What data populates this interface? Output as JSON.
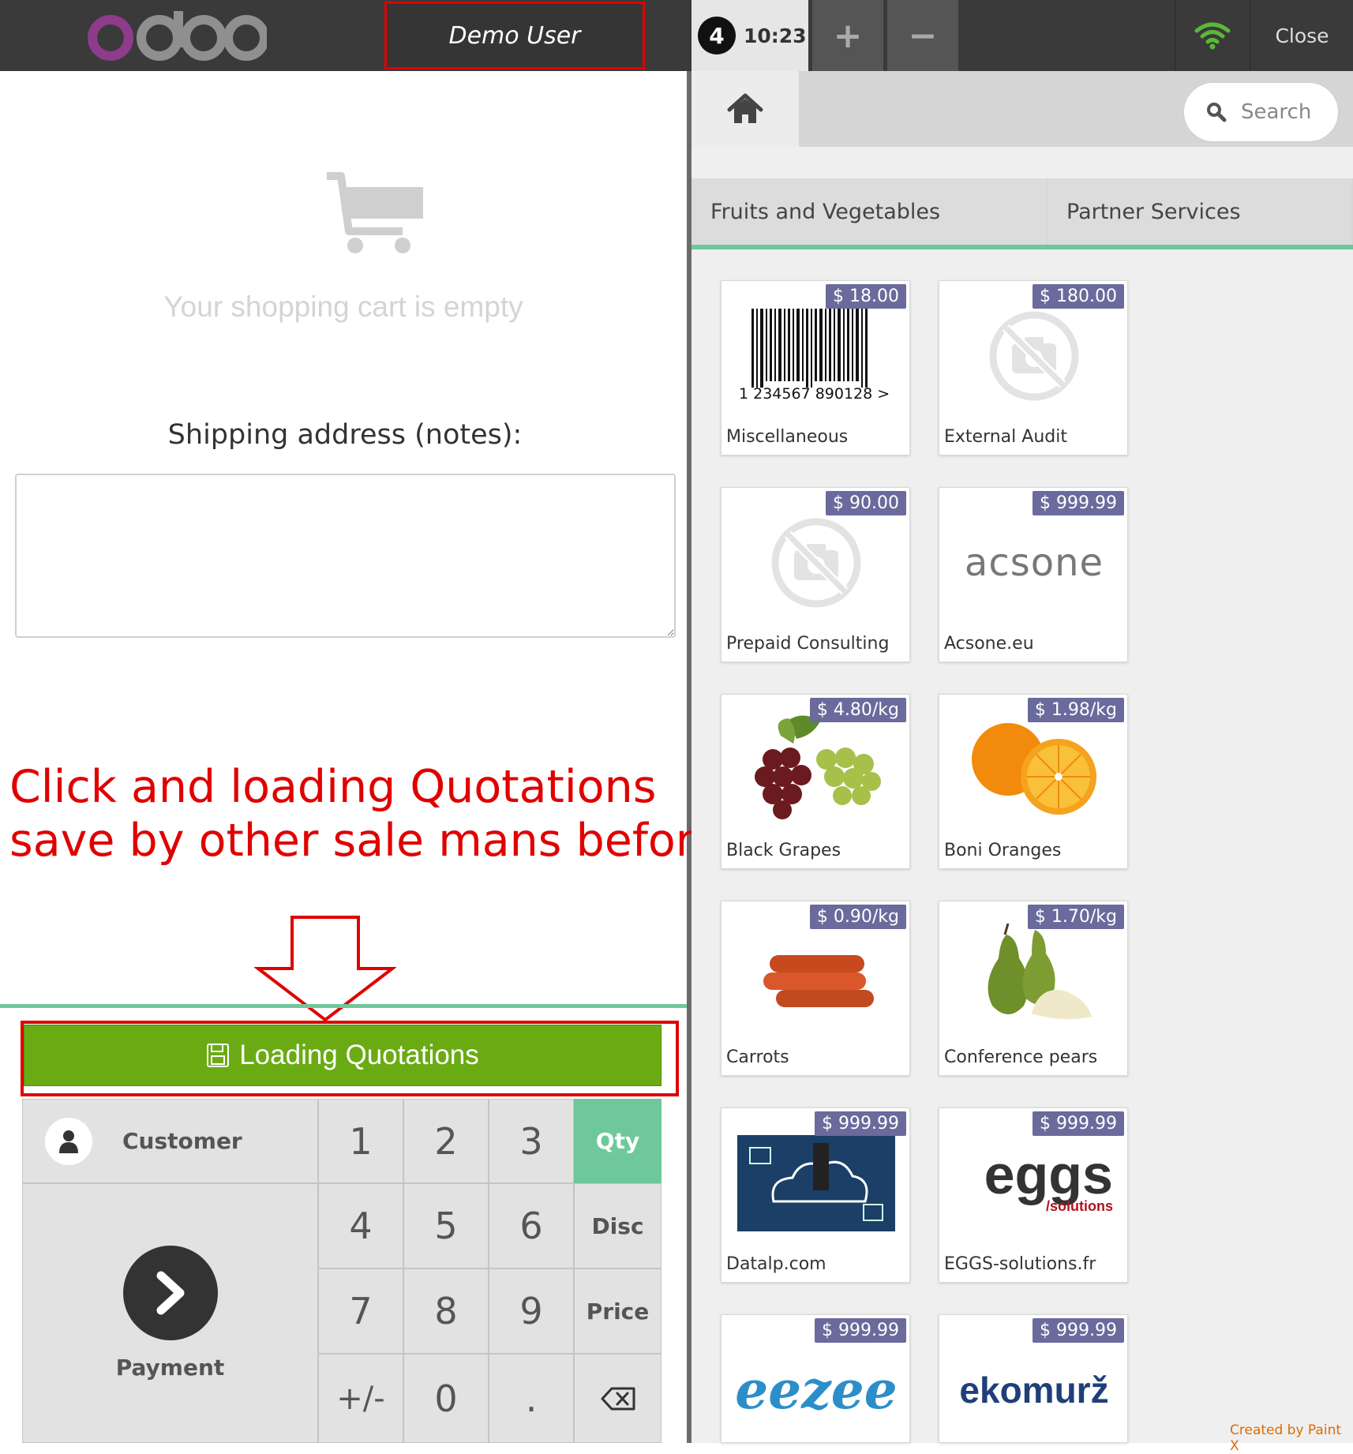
{
  "header": {
    "logo_text": "odoo",
    "user_name": "Demo User",
    "order_number": "4",
    "order_time": "10:23",
    "add_order_label": "+",
    "remove_order_label": "−",
    "close_label": "Close"
  },
  "cart": {
    "empty_message": "Your shopping cart is empty",
    "shipping_label": "Shipping address (notes):",
    "shipping_value": ""
  },
  "annotation": {
    "line1": "Click and loading Quotations",
    "line2": "save by other sale mans before."
  },
  "actions": {
    "loading_quotations_label": "Loading Quotations"
  },
  "numpad": {
    "customer_label": "Customer",
    "payment_label": "Payment",
    "keys": {
      "k1": "1",
      "k2": "2",
      "k3": "3",
      "k4": "4",
      "k5": "5",
      "k6": "6",
      "k7": "7",
      "k8": "8",
      "k9": "9",
      "k0": "0",
      "sign": "+/-",
      "dot": "."
    },
    "modes": {
      "qty": "Qty",
      "disc": "Disc",
      "price": "Price"
    },
    "active_mode": "Qty"
  },
  "products_panel": {
    "search_placeholder": "Search",
    "categories": [
      "Fruits and Vegetables",
      "Partner Services"
    ],
    "products": [
      {
        "name": "Miscellaneous",
        "price": "$ 18.00",
        "image": "barcode"
      },
      {
        "name": "External Audit",
        "price": "$ 180.00",
        "image": "no-photo"
      },
      {
        "name": "Prepaid Consulting",
        "price": "$ 90.00",
        "image": "no-photo"
      },
      {
        "name": "Acsone.eu",
        "price": "$ 999.99",
        "image": "acsone-logo"
      },
      {
        "name": "Black Grapes",
        "price": "$ 4.80/kg",
        "image": "grapes"
      },
      {
        "name": "Boni Oranges",
        "price": "$ 1.98/kg",
        "image": "oranges"
      },
      {
        "name": "Carrots",
        "price": "$ 0.90/kg",
        "image": "carrots"
      },
      {
        "name": "Conference pears",
        "price": "$ 1.70/kg",
        "image": "pears"
      },
      {
        "name": "Datalp.com",
        "price": "$ 999.99",
        "image": "cloud-business"
      },
      {
        "name": "EGGS-solutions.fr",
        "price": "$ 999.99",
        "image": "eggs-logo"
      },
      {
        "name": "",
        "price": "$ 999.99",
        "image": "eezee-logo"
      },
      {
        "name": "",
        "price": "$ 999.99",
        "image": "ekomurz-logo"
      }
    ],
    "barcode_text": "1  234567  890128  >",
    "acsone_logo_text": "acsone",
    "eggs_logo_text": "eggs",
    "eggs_logo_sub": "/solutions",
    "eezee_logo_text": "eezee",
    "ekomurz_logo_text": "ekomurž"
  },
  "watermark": "Created by Paint X",
  "colors": {
    "topbar": "#3a3a3a",
    "accent_green": "#6ec89b",
    "button_green": "#6aab14",
    "annotation_red": "#e00000",
    "price_badge": "#6a6a9c"
  }
}
